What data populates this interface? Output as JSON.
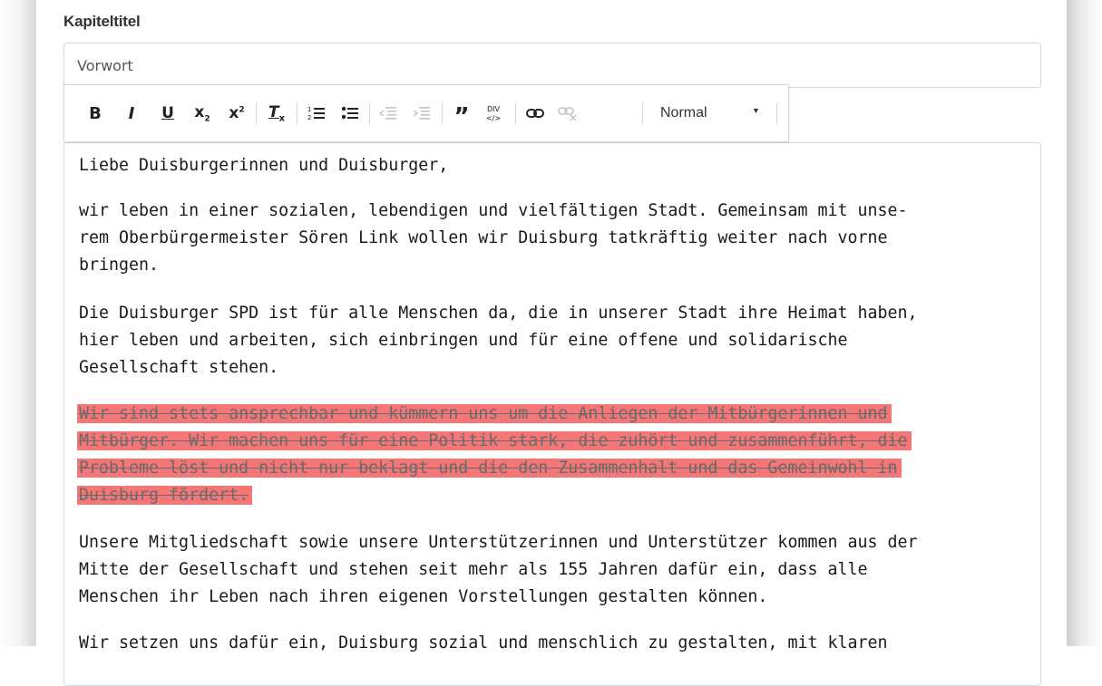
{
  "field": {
    "label": "Kapiteltitel",
    "value": "Vorwort"
  },
  "toolbar": {
    "buttons": [
      {
        "name": "bold-icon",
        "glyph": "B",
        "enabled": true
      },
      {
        "name": "italic-icon",
        "glyph": "I",
        "enabled": true
      },
      {
        "name": "underline-icon",
        "glyph": "U",
        "enabled": true
      },
      {
        "name": "subscript-icon",
        "glyph": "x₂",
        "enabled": true
      },
      {
        "name": "superscript-icon",
        "glyph": "x²",
        "enabled": true
      },
      {
        "name": "clear-format-icon",
        "glyph": "Tx",
        "enabled": true
      },
      {
        "name": "ordered-list-icon",
        "glyph": "1≡",
        "enabled": true
      },
      {
        "name": "bullet-list-icon",
        "glyph": "•≡",
        "enabled": true
      },
      {
        "name": "outdent-icon",
        "glyph": "⇤≡",
        "enabled": false
      },
      {
        "name": "indent-icon",
        "glyph": "⇥≡",
        "enabled": false
      },
      {
        "name": "blockquote-icon",
        "glyph": "❞",
        "enabled": true
      },
      {
        "name": "div-icon",
        "glyph": "DIV",
        "enabled": true
      },
      {
        "name": "link-icon",
        "glyph": "⛓",
        "enabled": true
      },
      {
        "name": "unlink-icon",
        "glyph": "⛓✕",
        "enabled": false
      }
    ],
    "format_select": "Normal"
  },
  "editor": {
    "paragraphs": [
      {
        "lines": [
          "Liebe Duisburgerinnen und Duisburger,"
        ],
        "deleted": false
      },
      {
        "lines": [
          "wir leben in einer sozialen, lebendigen und vielfältigen Stadt. Gemeinsam mit unse-",
          "rem Oberbürgermeister Sören Link wollen wir Duisburg tatkräftig weiter nach vorne",
          "bringen."
        ],
        "deleted": false
      },
      {
        "lines": [
          "Die Duisburger SPD ist für alle Menschen da, die in unserer Stadt ihre Heimat haben,",
          "hier leben und arbeiten, sich einbringen und für eine offene und solidarische",
          "Gesellschaft stehen."
        ],
        "deleted": false
      },
      {
        "lines": [
          "Wir sind stets ansprechbar und kümmern uns um die Anliegen der Mitbürgerinnen und",
          "Mitbürger. Wir machen uns für eine Politik stark, die zuhört und zusammenführt, die",
          "Probleme löst und nicht nur beklagt und die den Zusammenhalt und das Gemeinwohl in",
          "Duisburg fördert."
        ],
        "deleted": true
      },
      {
        "lines": [
          "Unsere Mitgliedschaft sowie unsere Unterstützerinnen und Unterstützer kommen aus der",
          "Mitte der Gesellschaft und stehen seit mehr als 155 Jahren dafür ein, dass alle",
          "Menschen ihr Leben nach ihren eigenen Vorstellungen gestalten können."
        ],
        "deleted": false
      },
      {
        "lines": [
          "Wir setzen uns dafür ein, Duisburg sozial und menschlich zu gestalten, mit klaren"
        ],
        "deleted": false
      }
    ]
  },
  "colors": {
    "deleted_highlight": "#f47676",
    "border": "#d2d6de"
  }
}
